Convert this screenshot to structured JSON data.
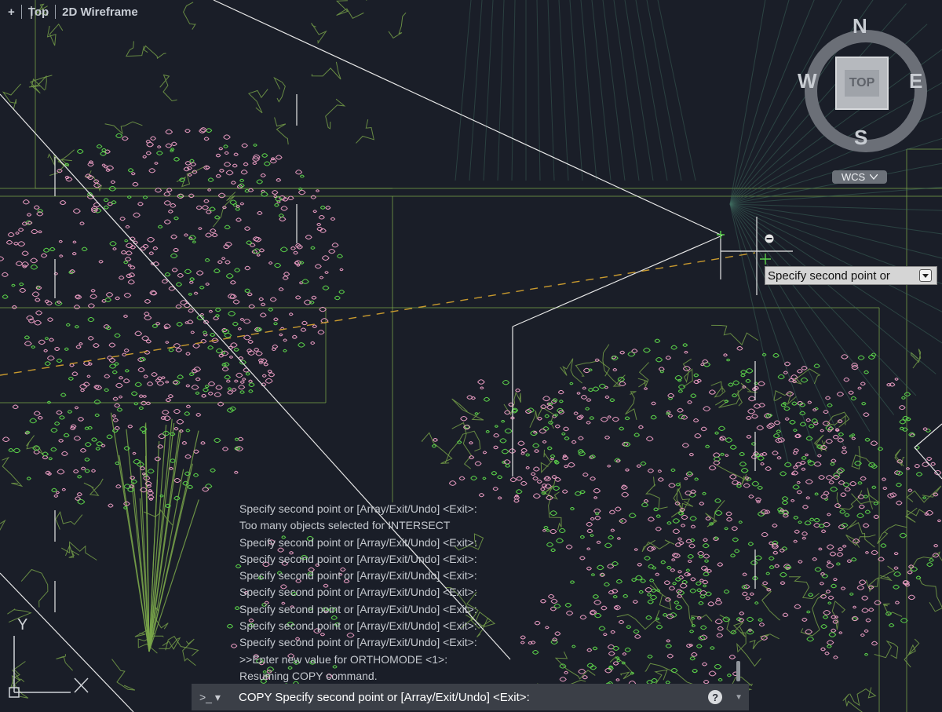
{
  "viewport_controls": {
    "plus": "+",
    "view": "Top",
    "visual_style": "2D Wireframe"
  },
  "viewcube": {
    "face": "TOP",
    "north": "N",
    "south": "S",
    "east": "E",
    "west": "W"
  },
  "wcs_menu": {
    "label": "WCS"
  },
  "ucs_icon": {
    "y_label": "Y"
  },
  "dynamic_input": {
    "text": "Specify second point or"
  },
  "command_history": [
    "Specify second point or [Array/Exit/Undo] <Exit>:",
    "Too many objects selected for INTERSECT",
    "Specify second point or [Array/Exit/Undo] <Exit>:",
    "Specify second point or [Array/Exit/Undo] <Exit>:",
    "Specify second point or [Array/Exit/Undo] <Exit>:",
    "Specify second point or [Array/Exit/Undo] <Exit>:",
    "Specify second point or [Array/Exit/Undo] <Exit>:",
    "Specify second point or [Array/Exit/Undo] <Exit>:",
    "Specify second point or [Array/Exit/Undo] <Exit>:",
    ">>Enter new value for ORTHOMODE <1>:",
    "Resuming COPY command."
  ],
  "command_line": {
    "prompt_icon": ">_",
    "text": "COPY Specify second point or [Array/Exit/Undo] <Exit>:",
    "help": "?"
  },
  "colors": {
    "background": "#1a1e28",
    "plant_outline": "#7aa64a",
    "flower_pink": "#e79ac0",
    "leaf_green": "#5bd24a",
    "white_lines": "#e6e6e6",
    "tracking_dash": "#c99a2e"
  }
}
